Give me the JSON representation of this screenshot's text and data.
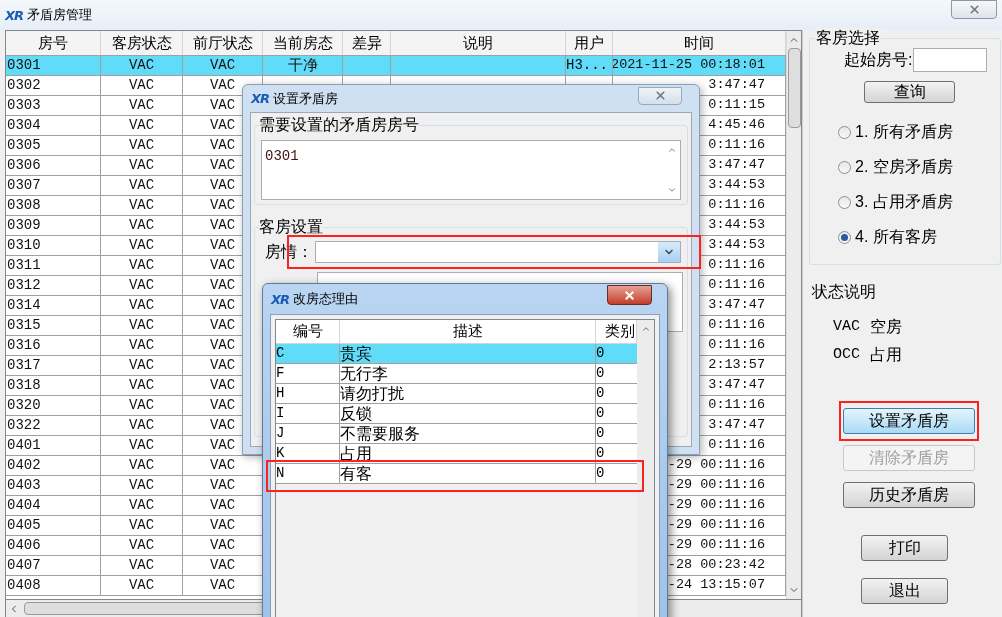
{
  "window": {
    "logo": "XR",
    "title": "矛盾房管理"
  },
  "table": {
    "columns": [
      "房号",
      "客房状态",
      "前厅状态",
      "当前房态",
      "差异",
      "说明",
      "用户",
      "时间"
    ],
    "rows": [
      {
        "room": "0301",
        "guest_status": "VAC",
        "front_status": "VAC",
        "current_status": "干净",
        "user": "H3...",
        "time": "2021-11-25 00:18:01",
        "selected": true
      },
      {
        "room": "0302",
        "guest_status": "VAC",
        "front_status": "VAC",
        "time": "3:47:47",
        "selected": false
      },
      {
        "room": "0303",
        "guest_status": "VAC",
        "front_status": "VAC",
        "time": "0:11:15",
        "selected": false
      },
      {
        "room": "0304",
        "guest_status": "VAC",
        "front_status": "VAC",
        "time": "4:45:46",
        "selected": false
      },
      {
        "room": "0305",
        "guest_status": "VAC",
        "front_status": "VAC",
        "time": "0:11:16",
        "selected": false
      },
      {
        "room": "0306",
        "guest_status": "VAC",
        "front_status": "VAC",
        "time": "3:47:47",
        "selected": false
      },
      {
        "room": "0307",
        "guest_status": "VAC",
        "front_status": "VAC",
        "time": "3:44:53",
        "selected": false
      },
      {
        "room": "0308",
        "guest_status": "VAC",
        "front_status": "VAC",
        "time": "0:11:16",
        "selected": false
      },
      {
        "room": "0309",
        "guest_status": "VAC",
        "front_status": "VAC",
        "time": "3:44:53",
        "selected": false
      },
      {
        "room": "0310",
        "guest_status": "VAC",
        "front_status": "VAC",
        "time": "3:44:53",
        "selected": false
      },
      {
        "room": "0311",
        "guest_status": "VAC",
        "front_status": "VAC",
        "time": "0:11:16",
        "selected": false
      },
      {
        "room": "0312",
        "guest_status": "VAC",
        "front_status": "VAC",
        "time": "0:11:16",
        "selected": false
      },
      {
        "room": "0314",
        "guest_status": "VAC",
        "front_status": "VAC",
        "time": "3:47:47",
        "selected": false
      },
      {
        "room": "0315",
        "guest_status": "VAC",
        "front_status": "VAC",
        "time": "0:11:16",
        "selected": false
      },
      {
        "room": "0316",
        "guest_status": "VAC",
        "front_status": "VAC",
        "time": "0:11:16",
        "selected": false
      },
      {
        "room": "0317",
        "guest_status": "VAC",
        "front_status": "VAC",
        "time": "2:13:57",
        "selected": false
      },
      {
        "room": "0318",
        "guest_status": "VAC",
        "front_status": "VAC",
        "time": "3:47:47",
        "selected": false
      },
      {
        "room": "0320",
        "guest_status": "VAC",
        "front_status": "VAC",
        "time": "0:11:16",
        "selected": false
      },
      {
        "room": "0322",
        "guest_status": "VAC",
        "front_status": "VAC",
        "time": "3:47:47",
        "selected": false
      },
      {
        "room": "0401",
        "guest_status": "VAC",
        "front_status": "VAC",
        "time": "0:11:16",
        "selected": false
      },
      {
        "room": "0402",
        "guest_status": "VAC",
        "front_status": "VAC",
        "time": "-29 00:11:16",
        "selected": false
      },
      {
        "room": "0403",
        "guest_status": "VAC",
        "front_status": "VAC",
        "time": "-29 00:11:16",
        "selected": false
      },
      {
        "room": "0404",
        "guest_status": "VAC",
        "front_status": "VAC",
        "time": "-29 00:11:16",
        "selected": false
      },
      {
        "room": "0405",
        "guest_status": "VAC",
        "front_status": "VAC",
        "time": "-29 00:11:16",
        "selected": false
      },
      {
        "room": "0406",
        "guest_status": "VAC",
        "front_status": "VAC",
        "time": "-29 00:11:16",
        "selected": false
      },
      {
        "room": "0407",
        "guest_status": "VAC",
        "front_status": "VAC",
        "time": "-28 00:23:42",
        "selected": false
      },
      {
        "room": "0408",
        "guest_status": "VAC",
        "front_status": "VAC",
        "time": "-24 13:15:07",
        "selected": false
      }
    ]
  },
  "room_selection": {
    "title": "客房选择",
    "start_room_label": "起始房号:",
    "query_button": "查询",
    "options": [
      {
        "label": "1. 所有矛盾房",
        "selected": false
      },
      {
        "label": "2. 空房矛盾房",
        "selected": false
      },
      {
        "label": "3. 占用矛盾房",
        "selected": false
      },
      {
        "label": "4. 所有客房",
        "selected": true
      }
    ]
  },
  "status_legend": {
    "title": "状态说明",
    "items": [
      {
        "code": "VAC",
        "meaning": "空房"
      },
      {
        "code": "OCC",
        "meaning": "占用"
      }
    ]
  },
  "actions": [
    {
      "label": "设置矛盾房",
      "disabled": false,
      "focused": true,
      "highlighted": true
    },
    {
      "label": "清除矛盾房",
      "disabled": true,
      "focused": false,
      "highlighted": false
    },
    {
      "label": "历史矛盾房",
      "disabled": false,
      "focused": false,
      "highlighted": false
    },
    {
      "label": "打印",
      "disabled": false,
      "focused": false,
      "highlighted": false
    },
    {
      "label": "退出",
      "disabled": false,
      "focused": false,
      "highlighted": false
    }
  ],
  "set_dialog": {
    "logo": "XR",
    "title": "设置矛盾房",
    "rooms_group": "需要设置的矛盾房房号",
    "rooms_value": "0301",
    "room_group": "客房设置",
    "status_label": "房情：",
    "status_highlighted": true
  },
  "reason_dialog": {
    "logo": "XR",
    "title": "改房态理由",
    "columns": [
      "编号",
      "描述",
      "类别"
    ],
    "rows": [
      {
        "code": "C",
        "description": "贵宾",
        "category": "0",
        "selected": true,
        "highlighted": false
      },
      {
        "code": "F",
        "description": "无行李",
        "category": "0",
        "selected": false,
        "highlighted": false
      },
      {
        "code": "H",
        "description": "请勿打扰",
        "category": "0",
        "selected": false,
        "highlighted": false
      },
      {
        "code": "I",
        "description": "反锁",
        "category": "0",
        "selected": false,
        "highlighted": false
      },
      {
        "code": "J",
        "description": "不需要服务",
        "category": "0",
        "selected": false,
        "highlighted": false
      },
      {
        "code": "K",
        "description": "占用",
        "category": "0",
        "selected": false,
        "highlighted": false
      },
      {
        "code": "N",
        "description": "有客",
        "category": "0",
        "selected": false,
        "highlighted": true
      }
    ]
  }
}
